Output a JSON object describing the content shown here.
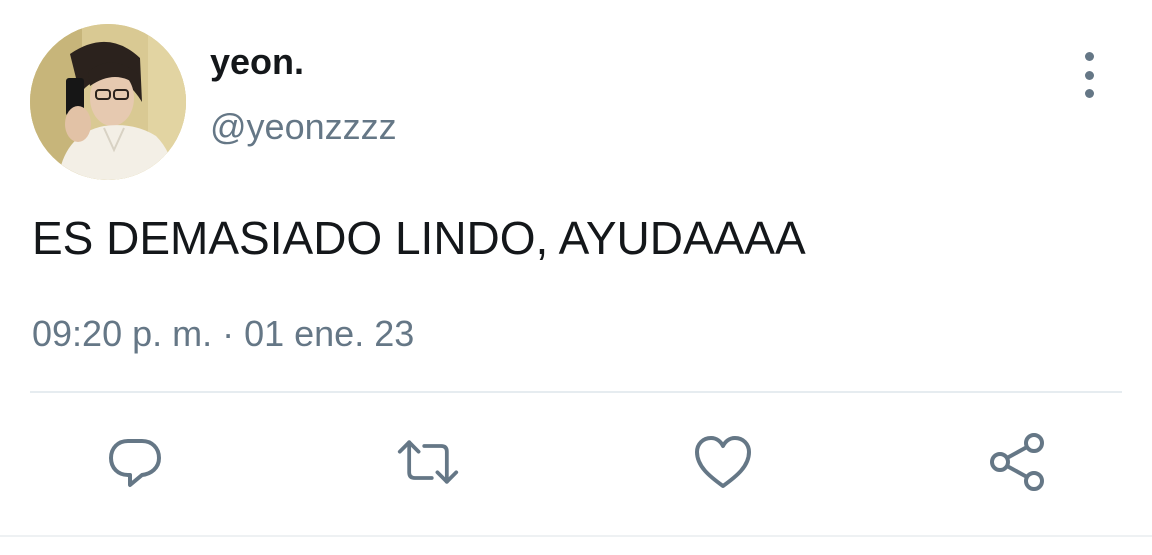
{
  "tweet": {
    "author": {
      "display_name": "yeon.",
      "handle": "@yeonzzzz",
      "avatar_icon": "profile-photo"
    },
    "text": "ES DEMASIADO LINDO, AYUDAAAA",
    "timestamp": "09:20 p. m. · 01 ene. 23"
  },
  "actions": [
    {
      "icon": "reply-icon"
    },
    {
      "icon": "retweet-icon"
    },
    {
      "icon": "like-icon"
    },
    {
      "icon": "share-icon"
    }
  ],
  "colors": {
    "text": "#14171a",
    "secondary": "#657786",
    "divider": "#e6ecf0",
    "icon": "#657786"
  }
}
